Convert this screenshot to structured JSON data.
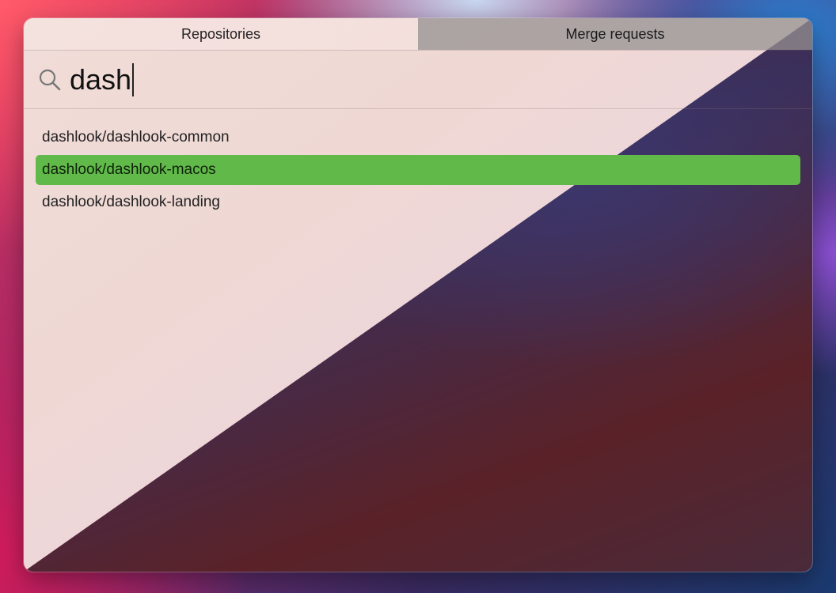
{
  "tabs": [
    {
      "label": "Repositories",
      "active": true
    },
    {
      "label": "Merge requests",
      "active": false
    }
  ],
  "search": {
    "value": "dash",
    "icon": "search-icon"
  },
  "results": [
    {
      "label": "dashlook/dashlook-common",
      "selected": false
    },
    {
      "label": "dashlook/dashlook-macos",
      "selected": true
    },
    {
      "label": "dashlook/dashlook-landing",
      "selected": false
    }
  ],
  "colors": {
    "selection": "#61b94a"
  }
}
